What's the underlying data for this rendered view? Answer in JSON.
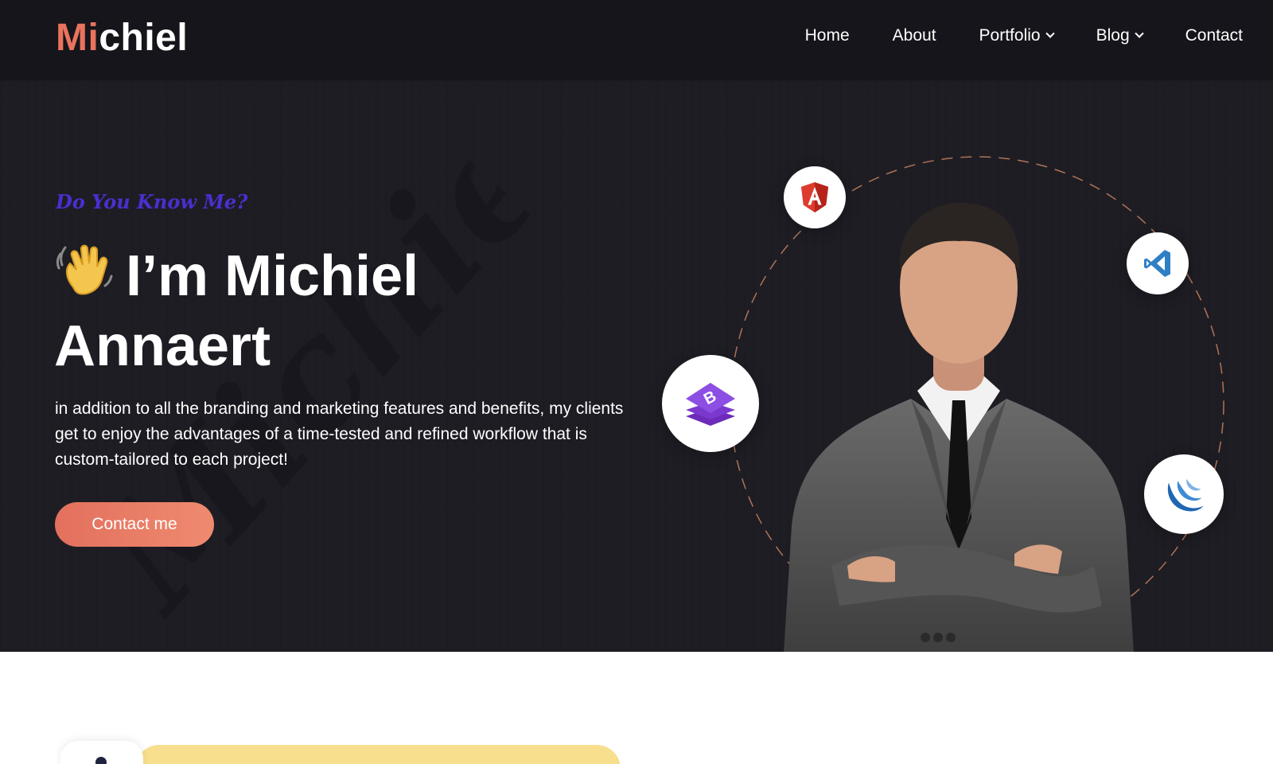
{
  "brand": {
    "logo_accent": "Mi",
    "logo_rest": "chiel",
    "accent_color": "#e9735e"
  },
  "nav": {
    "items": [
      {
        "label": "Home",
        "has_dropdown": false
      },
      {
        "label": "About",
        "has_dropdown": false
      },
      {
        "label": "Portfolio",
        "has_dropdown": true
      },
      {
        "label": "Blog",
        "has_dropdown": true
      },
      {
        "label": "Contact",
        "has_dropdown": false
      }
    ]
  },
  "hero": {
    "eyebrow": "Do You Know Me?",
    "title_line1": "I’m Michiel",
    "title_line2": "Annaert",
    "description": "in addition to all the branding and marketing features and benefits, my clients get to enjoy the advantages of a time-tested and refined workflow that is custom-tailored to each project!",
    "cta_label": "Contact me",
    "watermark_text": "Michiel",
    "wave_icon": "waving-hand-icon",
    "tech_icons": [
      "angular-icon",
      "vscode-icon",
      "bootstrap-icon",
      "jquery-icon"
    ]
  },
  "colors": {
    "nav_bg": "#16151b",
    "hero_bg": "#1e1d24",
    "eyebrow": "#4a2fd0",
    "cta_start": "#e2705d",
    "cta_end": "#ef8a6f",
    "yellow_tab": "#f7df8e"
  }
}
